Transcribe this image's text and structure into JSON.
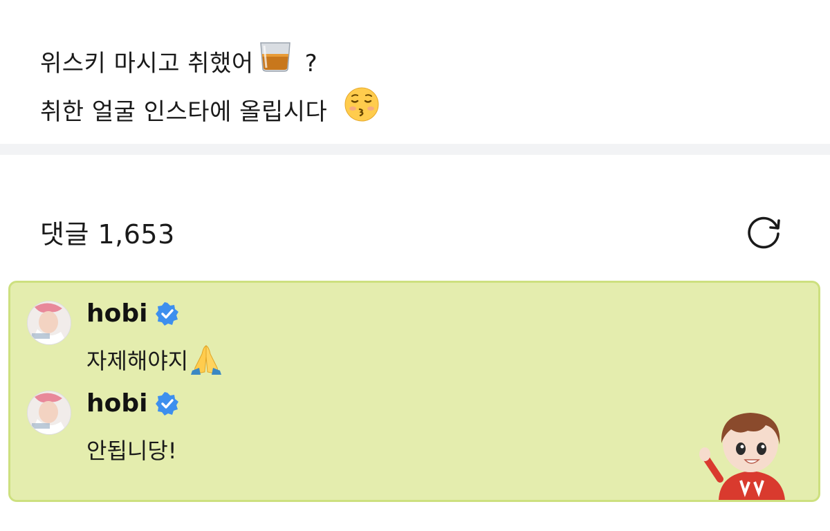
{
  "post": {
    "line1": "위스키 마시고 취했어",
    "line1_suffix": "?",
    "line2": "취한 얼굴 인스타에 올립시다",
    "emojis": [
      "tumbler-glass-icon",
      "kissing-face-icon"
    ]
  },
  "comments_header": {
    "label": "댓글 1,653",
    "refresh_icon": "refresh-icon"
  },
  "comments": [
    {
      "author": "hobi",
      "verified": true,
      "text": "자제해야지",
      "emoji": "folded-hands-icon"
    },
    {
      "author": "hobi",
      "verified": true,
      "text": "안됩니당!"
    }
  ],
  "colors": {
    "card_bg": "#e4edae",
    "card_border": "#cde07f",
    "verified_blue": "#3d8fee",
    "divider": "#f2f3f5"
  }
}
